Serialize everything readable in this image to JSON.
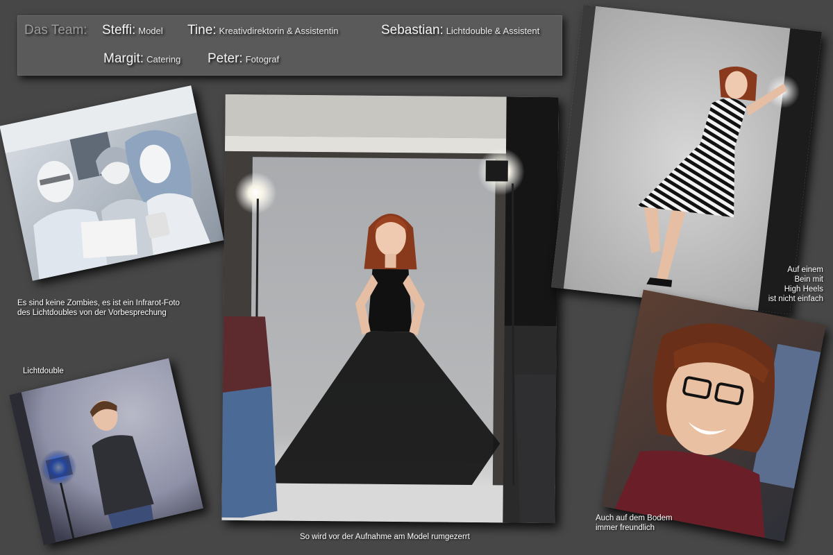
{
  "team": {
    "title": "Das Team:",
    "members": [
      {
        "name": "Steffi:",
        "role": "Model"
      },
      {
        "name": "Tine:",
        "role": "Kreativdirektorin & Assistentin"
      },
      {
        "name": "Sebastian:",
        "role": "Lichtdouble & Assistent"
      },
      {
        "name": "Margit:",
        "role": "Catering"
      },
      {
        "name": "Peter:",
        "role": "Fotograf"
      }
    ]
  },
  "captions": {
    "infrared": [
      "Es sind keine Zombies, es ist ein Infrarot-Foto",
      "des Lichtdoubles von der Vorbesprechung"
    ],
    "lichtdouble": "Lichtdouble",
    "main": "So wird vor der Aufnahme am Model rumgezerrt",
    "high_heels": [
      "Auf einem",
      "Bein mit",
      "High Heels",
      "ist nicht einfach"
    ],
    "smile": [
      "Auch auf dem Bodem",
      "immer freundlich"
    ]
  }
}
